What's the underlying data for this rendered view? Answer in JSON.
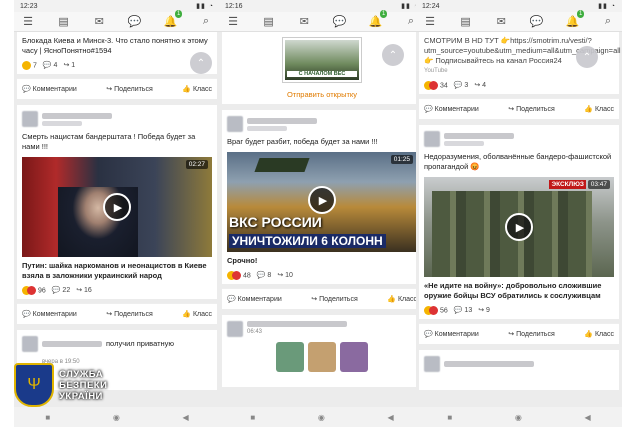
{
  "screens": [
    {
      "status_time": "12:23",
      "notif_badge": "1",
      "post1_text": "Блокада Киева и Минск-3. Что стало понятно к этому часу | ЯсноПонятно#1594",
      "post1_stats": [
        "7",
        "4",
        "1"
      ],
      "actions": [
        "Комментарии",
        "Поделиться",
        "Класс"
      ],
      "post2_text": "Смерть нацистам бандерштата ! Победа будет за нами !!!",
      "video_duration": "02:27",
      "post2_caption": "Путин: шайка наркоманов и неонацистов в Киеве взяла в заложники украинский народ",
      "post2_stats": [
        "96",
        "22",
        "16"
      ],
      "post3_text": "получил приватную",
      "post3_time": "вчера в 19:50",
      "logo_text": [
        "СЛУЖБА",
        "БЕЗПЕКИ",
        "УКРАЇНИ"
      ]
    },
    {
      "status_time": "12:16",
      "notif_badge": "1",
      "postcard_caption": "С НАЧАЛОМ ВЕС",
      "send_postcard": "Отправить открытку",
      "post2_text": "Враг будет разбит, победа будет за нами !!!",
      "video_duration": "01:25",
      "video_overlay_line1": "ВКС РОССИИ",
      "video_overlay_line2": "УНИЧТОЖИЛИ 6 КОЛОНН",
      "post2_caption": "Срочно!",
      "post2_stats": [
        "48",
        "8",
        "10"
      ],
      "actions": [
        "Комментарии",
        "Поделиться",
        "Класс"
      ],
      "post3_time": "06:43"
    },
    {
      "status_time": "12:24",
      "notif_badge": "1",
      "post1_text": "СМОТРИМ В HD ТУТ 👉https://smotrim.ru/vesti/?utm_source=youtube&utm_medium=all&utm_campaign=all 👉 Подписывайтесь на канал Россия24",
      "post1_source": "YouTube",
      "post1_stats": [
        "34",
        "3",
        "4"
      ],
      "actions": [
        "Комментарии",
        "Поделиться",
        "Класс"
      ],
      "post2_text": "Недоразумения, оболванённые бандеро-фашистской пропагандой 😡",
      "video_duration": "03:47",
      "video_tag": "ЭКСКЛЮЗ",
      "post2_caption": "«Не идите на войну»: добровольно сложившие оружие бойцы ВСУ обратились к сослуживцам",
      "post2_stats": [
        "56",
        "13",
        "9"
      ]
    }
  ],
  "icons": [
    "menu-icon",
    "feed-icon",
    "mail-icon",
    "chat-icon",
    "bell-icon",
    "search-icon",
    "play-icon",
    "back-nav-icon",
    "home-nav-icon",
    "recent-nav-icon",
    "scroll-up-icon"
  ]
}
